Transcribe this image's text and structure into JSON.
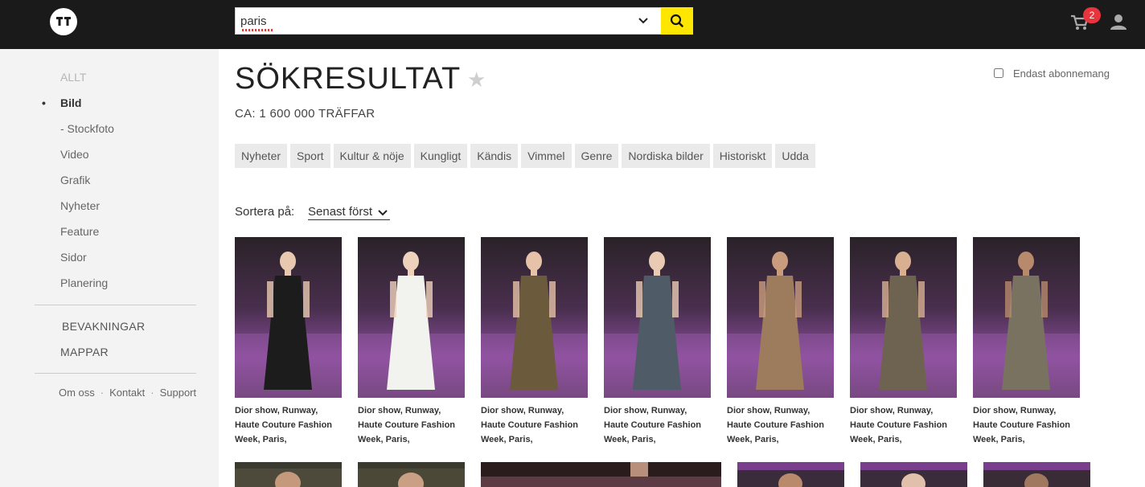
{
  "header": {
    "search_value": "paris",
    "cart_count": "2"
  },
  "sidebar": {
    "items": [
      {
        "label": "ALLT",
        "state": "faded"
      },
      {
        "label": "Bild",
        "state": "active"
      },
      {
        "label": "- Stockfoto",
        "state": "normal"
      },
      {
        "label": "Video",
        "state": "normal"
      },
      {
        "label": "Grafik",
        "state": "normal"
      },
      {
        "label": "Nyheter",
        "state": "normal"
      },
      {
        "label": "Feature",
        "state": "normal"
      },
      {
        "label": "Sidor",
        "state": "normal"
      },
      {
        "label": "Planering",
        "state": "normal"
      }
    ],
    "bevakningar": "BEVAKNINGAR",
    "mappar": "MAPPAR",
    "footer": {
      "about": "Om oss",
      "contact": "Kontakt",
      "support": "Support",
      "separator": "·"
    }
  },
  "main": {
    "title": "SÖKRESULTAT",
    "result_count": "CA: 1 600 000 TRÄFFAR",
    "subscription_label": "Endast abonnemang",
    "categories": [
      "Nyheter",
      "Sport",
      "Kultur & nöje",
      "Kungligt",
      "Kändis",
      "Vimmel",
      "Genre",
      "Nordiska bilder",
      "Historiskt",
      "Udda"
    ],
    "sort_label": "Sortera på:",
    "sort_value": "Senast först",
    "results": [
      {
        "caption": "Dior show, Runway, Haute Couture Fashion Week, Paris,",
        "dress": "#1c1c1c"
      },
      {
        "caption": "Dior show, Runway, Haute Couture Fashion Week, Paris,",
        "dress": "#f2f2ee"
      },
      {
        "caption": "Dior show, Runway, Haute Couture Fashion Week, Paris,",
        "dress": "#6b5a3c"
      },
      {
        "caption": "Dior show, Runway, Haute Couture Fashion Week, Paris,",
        "dress": "#4f5b66"
      },
      {
        "caption": "Dior show, Runway, Haute Couture Fashion Week, Paris,",
        "dress": "#9c7c5c"
      },
      {
        "caption": "Dior show, Runway, Haute Couture Fashion Week, Paris,",
        "dress": "#6e6350"
      },
      {
        "caption": "Dior show, Runway, Haute Couture Fashion Week, Paris,",
        "dress": "#7a7260"
      }
    ]
  },
  "colors": {
    "topbar": "#1a1a1a",
    "search_button": "#ffe600",
    "badge": "#e8343c",
    "runway_purple": "#7a3f8c"
  }
}
